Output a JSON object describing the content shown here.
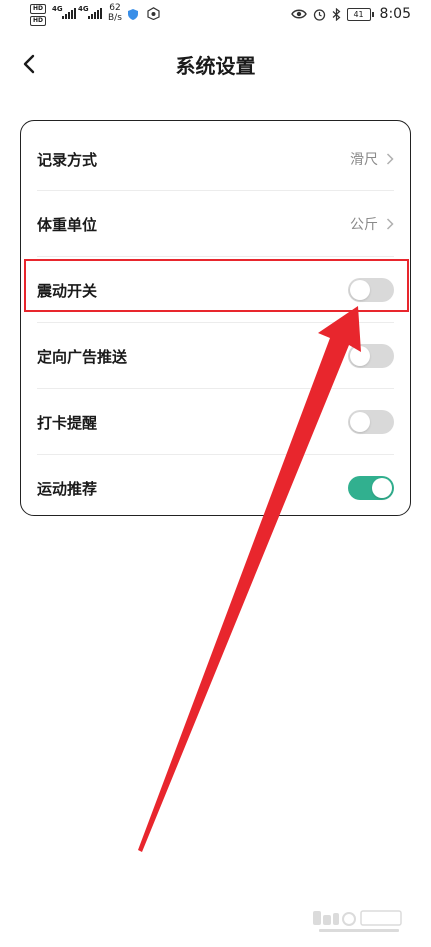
{
  "status_bar": {
    "network_a": "4G",
    "network_b": "4G",
    "speed_value": "62",
    "speed_unit": "B/s",
    "battery": "41",
    "time": "8:05"
  },
  "header": {
    "title": "系统设置"
  },
  "settings": {
    "record_method": {
      "label": "记录方式",
      "value": "滑尺"
    },
    "weight_unit": {
      "label": "体重单位",
      "value": "公斤"
    },
    "vibration": {
      "label": "震动开关",
      "on": false
    },
    "targeted_ads": {
      "label": "定向广告推送",
      "on": false
    },
    "checkin_reminder": {
      "label": "打卡提醒",
      "on": false
    },
    "exercise_recommend": {
      "label": "运动推荐",
      "on": true
    }
  },
  "colors": {
    "toggle_on": "#31b08f",
    "toggle_off": "#d9d9d9",
    "annotation_red": "#e8262d"
  }
}
